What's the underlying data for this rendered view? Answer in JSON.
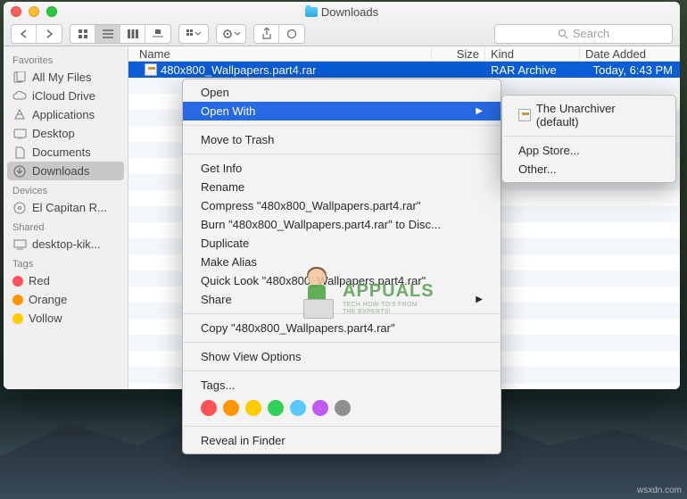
{
  "window": {
    "title": "Downloads",
    "search_placeholder": "Search"
  },
  "sidebar": {
    "headers": {
      "favorites": "Favorites",
      "devices": "Devices",
      "shared": "Shared",
      "tags": "Tags"
    },
    "favorites": [
      {
        "label": "All My Files",
        "glyph": "files"
      },
      {
        "label": "iCloud Drive",
        "glyph": "cloud"
      },
      {
        "label": "Applications",
        "glyph": "apps"
      },
      {
        "label": "Desktop",
        "glyph": "desktop"
      },
      {
        "label": "Documents",
        "glyph": "docs"
      },
      {
        "label": "Downloads",
        "glyph": "downloads",
        "active": true
      }
    ],
    "devices": [
      {
        "label": "El Capitan R...",
        "glyph": "disk"
      }
    ],
    "shared": [
      {
        "label": "desktop-kik...",
        "glyph": "screen"
      }
    ],
    "tags": [
      {
        "label": "Red",
        "color": "#ff5257"
      },
      {
        "label": "Orange",
        "color": "#ff9500"
      },
      {
        "label": "Vollow",
        "color": "#ffcc00"
      }
    ]
  },
  "columns": {
    "name": "Name",
    "size": "Size",
    "kind": "Kind",
    "date": "Date Added"
  },
  "file": {
    "name": "480x800_Wallpapers.part4.rar",
    "kind": "RAR Archive",
    "date": "Today, 6:43 PM"
  },
  "menu": {
    "open": "Open",
    "open_with": "Open With",
    "trash": "Move to Trash",
    "get_info": "Get Info",
    "rename": "Rename",
    "compress": "Compress \"480x800_Wallpapers.part4.rar\"",
    "burn": "Burn \"480x800_Wallpapers.part4.rar\" to Disc...",
    "duplicate": "Duplicate",
    "alias": "Make Alias",
    "quick_look": "Quick Look \"480x800_Wallpapers.part4.rar\"",
    "share": "Share",
    "copy": "Copy \"480x800_Wallpapers.part4.rar\"",
    "view_opts": "Show View Options",
    "tags": "Tags...",
    "reveal": "Reveal in Finder",
    "tag_colors": [
      "#ff5257",
      "#ff9500",
      "#ffcc00",
      "#30d158",
      "#5ac8fa",
      "#bf5af2",
      "#8e8e93"
    ]
  },
  "submenu": {
    "default": "The Unarchiver (default)",
    "app_store": "App Store...",
    "other": "Other..."
  },
  "watermark": {
    "title": "APPUALS",
    "sub1": "TECH HOW-TO'S FROM",
    "sub2": "THE EXPERTS!"
  },
  "source": "wsxdn.com"
}
